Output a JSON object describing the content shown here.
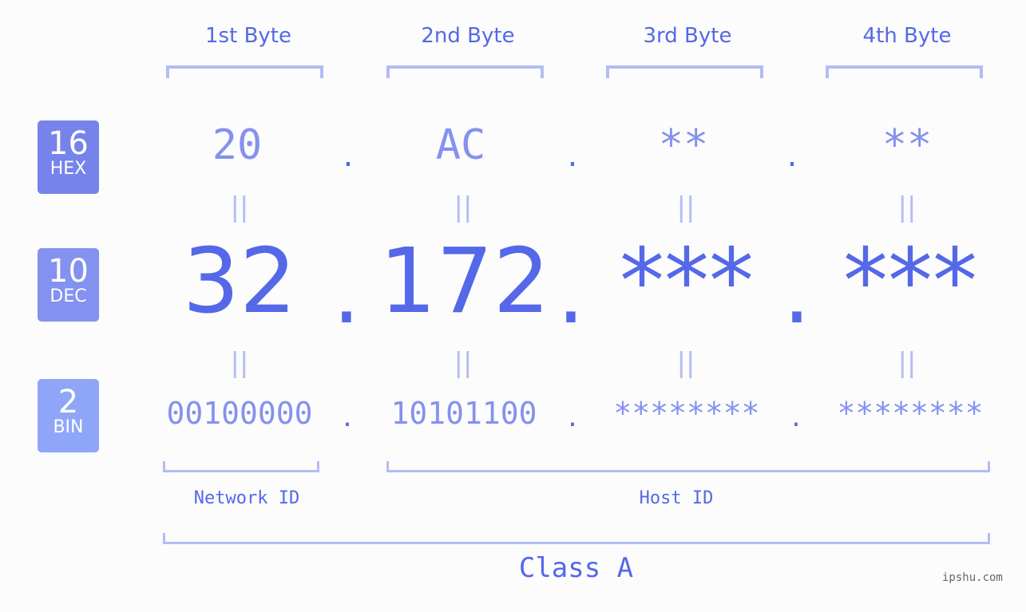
{
  "byte_headers": [
    "1st Byte",
    "2nd Byte",
    "3rd Byte",
    "4th Byte"
  ],
  "rows": {
    "hex": {
      "base": "16",
      "label": "HEX",
      "color": "#7583ea",
      "values": [
        "20",
        "AC",
        "**",
        "**"
      ]
    },
    "dec": {
      "base": "10",
      "label": "DEC",
      "color": "#8391f0",
      "values": [
        "32",
        "172",
        "***",
        "***"
      ]
    },
    "bin": {
      "base": "2",
      "label": "BIN",
      "color": "#8fa6f8",
      "values": [
        "00100000",
        "10101100",
        "********",
        "********"
      ]
    }
  },
  "separator": ".",
  "equals_symbol": "||",
  "parts": {
    "network": "Network ID",
    "host": "Host ID"
  },
  "ip_class": "Class A",
  "watermark": "ipshu.com",
  "colors": {
    "primary": "#5468e8",
    "secondary": "#8591ee",
    "bracket": "#b3bcf6",
    "background": "#fbfcfb"
  }
}
